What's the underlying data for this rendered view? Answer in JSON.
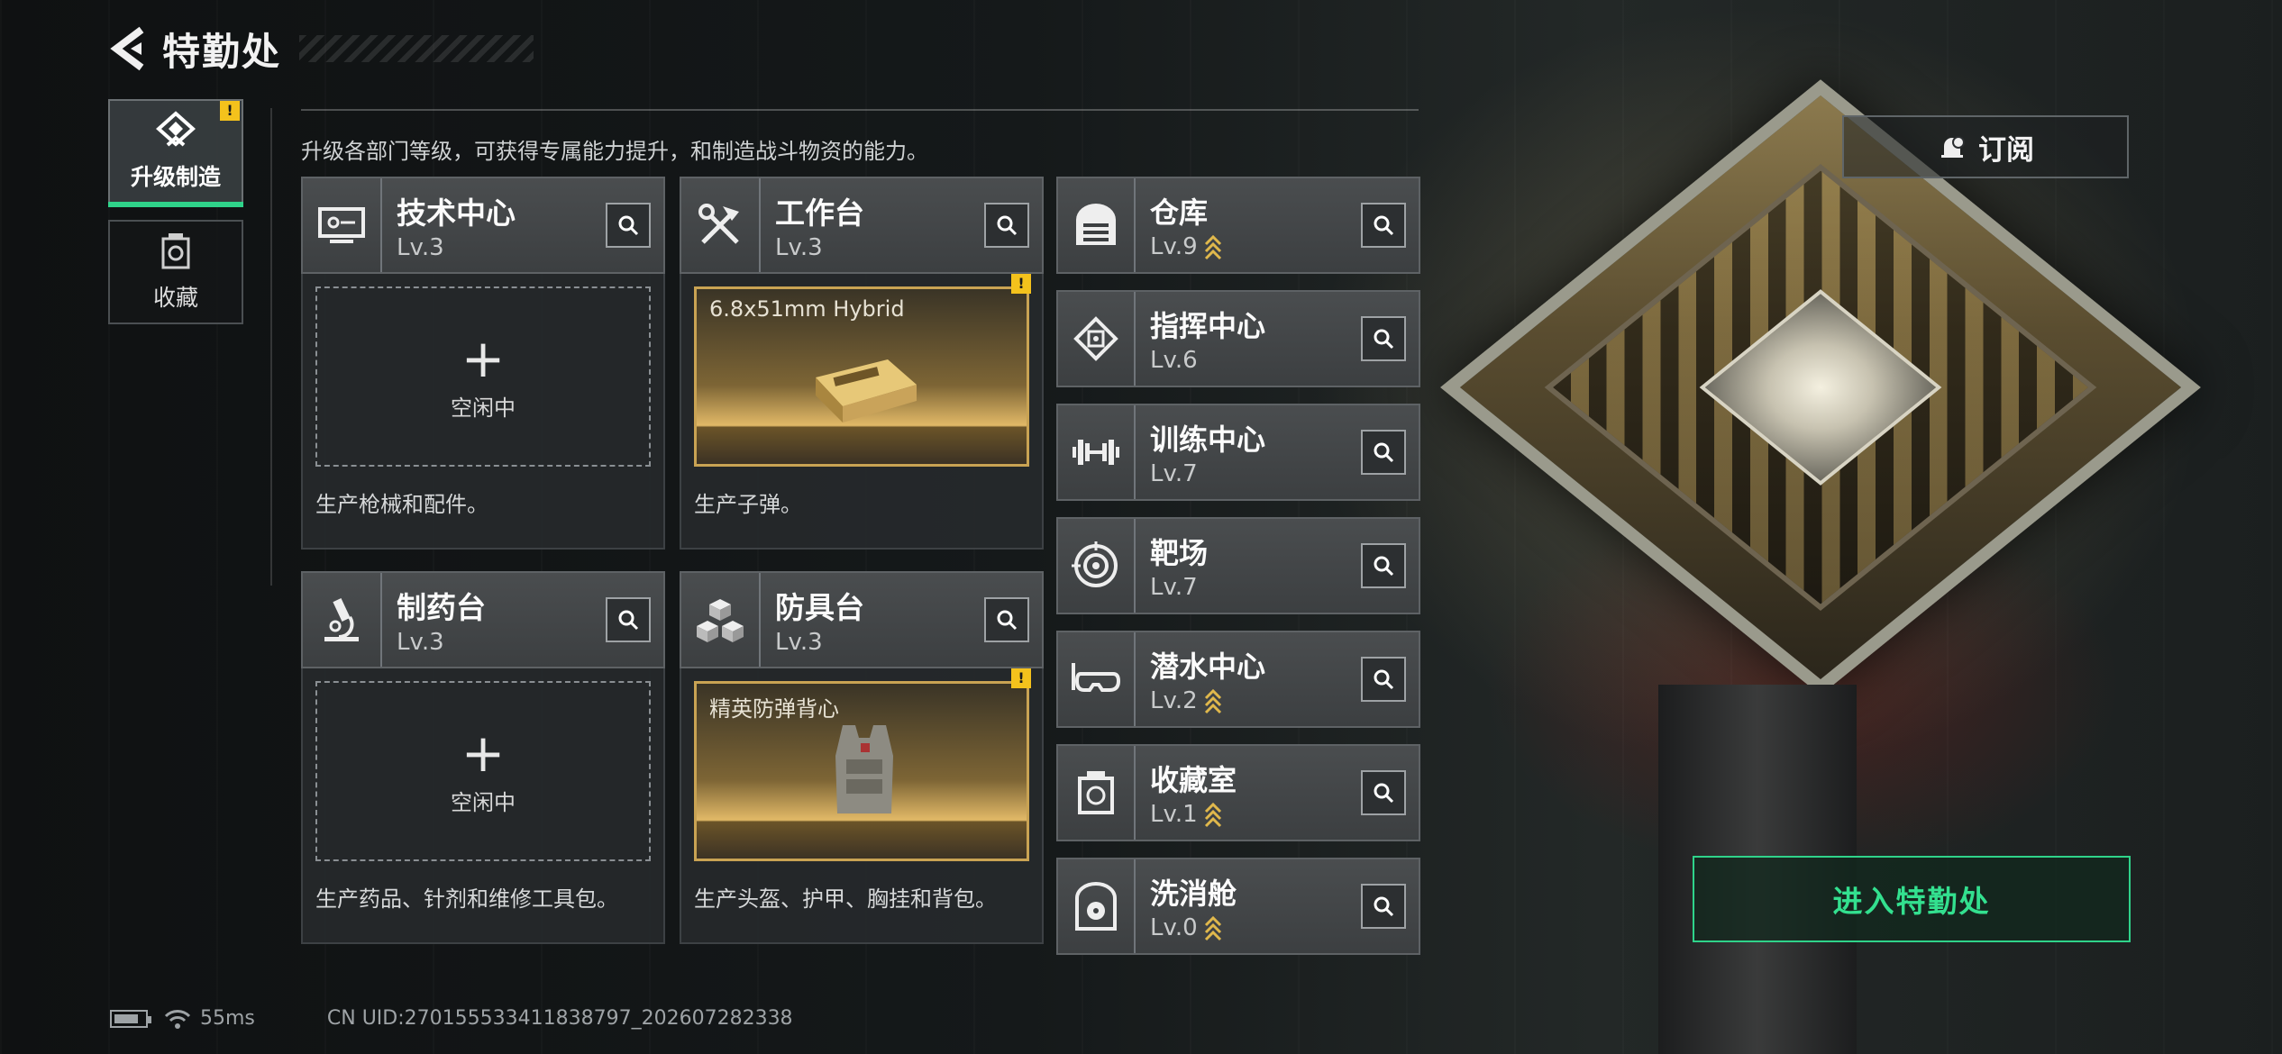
{
  "header": {
    "title": "特勤处"
  },
  "nav": {
    "items": [
      {
        "label": "升级制造",
        "active": true,
        "badge": "!"
      },
      {
        "label": "收藏",
        "active": false
      }
    ]
  },
  "description": "升级各部门等级，可获得专属能力提升，和制造战斗物资的能力。",
  "subscribe_label": "订阅",
  "enter_label": "进入特勤处",
  "stations": [
    {
      "name": "技术中心",
      "level": "Lv.3",
      "icon": "monitor-icon",
      "status": "空闲中",
      "desc": "生产枪械和配件。"
    },
    {
      "name": "工作台",
      "level": "Lv.3",
      "icon": "tools-icon",
      "product": "6.8x51mm Hybrid",
      "badge": "!",
      "desc": "生产子弹。"
    },
    {
      "name": "制药台",
      "level": "Lv.3",
      "icon": "microscope-icon",
      "status": "空闲中",
      "desc": "生产药品、针剂和维修工具包。"
    },
    {
      "name": "防具台",
      "level": "Lv.3",
      "icon": "cubes-icon",
      "product": "精英防弹背心",
      "badge": "!",
      "desc": "生产头盔、护甲、胸挂和背包。"
    }
  ],
  "departments": [
    {
      "name": "仓库",
      "level": "Lv.9",
      "icon": "warehouse-icon",
      "upgradable": true
    },
    {
      "name": "指挥中心",
      "level": "Lv.6",
      "icon": "chip-icon",
      "upgradable": false
    },
    {
      "name": "训练中心",
      "level": "Lv.7",
      "icon": "dumbbell-icon",
      "upgradable": false
    },
    {
      "name": "靶场",
      "level": "Lv.7",
      "icon": "target-icon",
      "upgradable": false
    },
    {
      "name": "潜水中心",
      "level": "Lv.2",
      "icon": "diving-mask-icon",
      "upgradable": true
    },
    {
      "name": "收藏室",
      "level": "Lv.1",
      "icon": "trophy-icon",
      "upgradable": true
    },
    {
      "name": "洗消舱",
      "level": "Lv.0",
      "icon": "radiation-icon",
      "upgradable": true
    }
  ],
  "status_bar": {
    "ping": "55ms",
    "uid": "CN UID:270155533411838797_202607282338"
  },
  "colors": {
    "accent": "#2fd38a",
    "badge": "#f4c21c",
    "product_border": "#c9a353"
  }
}
